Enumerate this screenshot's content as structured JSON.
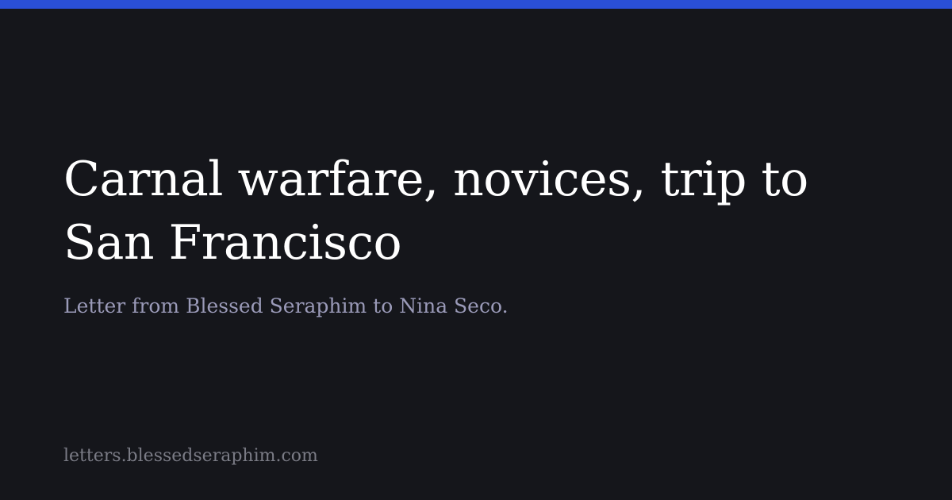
{
  "card": {
    "title": "Carnal warfare, novices, trip to San Francisco",
    "subtitle": "Letter from Blessed Seraphim to Nina Seco.",
    "site": "letters.blessedseraphim.com"
  },
  "colors": {
    "background": "#15161b",
    "accent": "#2a4fd6",
    "title": "#ffffff",
    "subtitle": "#9a9ab8",
    "site": "#7a7b85"
  }
}
